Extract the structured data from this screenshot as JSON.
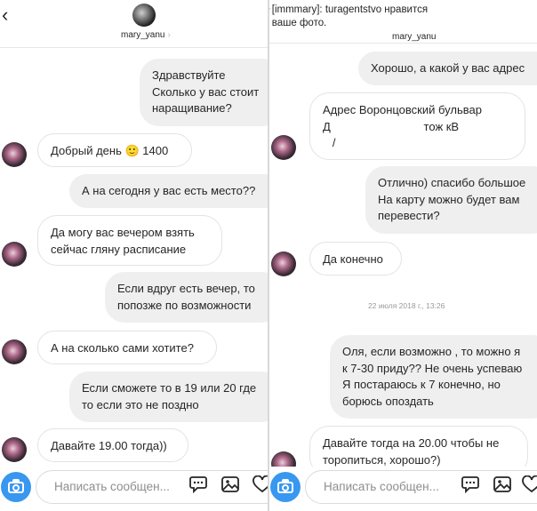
{
  "left": {
    "header": {
      "username": "mary_yanu",
      "chevron": "›"
    },
    "messages": [
      {
        "dir": "out",
        "text": "Здравствуйте\nСколько у вас стоит\nнаращивание?"
      },
      {
        "dir": "in",
        "text": "Добрый день 🙂 1400"
      },
      {
        "dir": "out",
        "text": "А на сегодня у вас есть место??"
      },
      {
        "dir": "in",
        "text": "Да могу вас вечером взять\nсейчас гляну расписание"
      },
      {
        "dir": "out",
        "text": "Если вдруг есть вечер, то\nпопозже по возможности"
      },
      {
        "dir": "in",
        "text": "А на сколько сами хотите?"
      },
      {
        "dir": "out",
        "text": "Если сможете то в 19 или 20 где\nто если это не поздно"
      },
      {
        "dir": "in",
        "text": "Давайте 19.00 тогда))"
      }
    ],
    "footer": {
      "placeholder": "Написать сообщен...",
      "icons": [
        "camera-icon",
        "chat-bubble-icon",
        "image-icon",
        "heart-icon"
      ]
    }
  },
  "right": {
    "notification": {
      "text": "[immmary]: turagentstvo нравится\nваше фото.",
      "icon": "star-icon"
    },
    "header": {
      "username": "mary_yanu"
    },
    "messages": [
      {
        "dir": "out",
        "text": "Хорошо, а какой у вас адрес"
      },
      {
        "dir": "in",
        "text": "Адрес Воронцовский бульвар\nД                             тож кВ\n   /"
      },
      {
        "dir": "out",
        "text": "Отлично) спасибо большое\nНа карту можно будет вам\nперевести?"
      },
      {
        "dir": "in",
        "text": "Да конечно"
      },
      {
        "dir": "out",
        "text": "Оля, если возможно , то можно я\nк 7-30 приду?? Не очень успеваю\nЯ постараюсь к 7 конечно, но\nборюсь опоздать"
      },
      {
        "dir": "in",
        "text": "Давайте тогда на 20.00 чтобы не\nторопиться, хорошо?)"
      }
    ],
    "timestamp": "22 июля 2018 г., 13:26",
    "footer": {
      "placeholder": "Написать сообщен...",
      "icons": [
        "camera-icon",
        "chat-bubble-icon",
        "image-icon",
        "heart-icon"
      ]
    }
  },
  "colors": {
    "accent": "#3897f0",
    "bubble_out": "#efefef",
    "bubble_in_border": "#e3e3e3",
    "placeholder": "#8e8e8e"
  }
}
